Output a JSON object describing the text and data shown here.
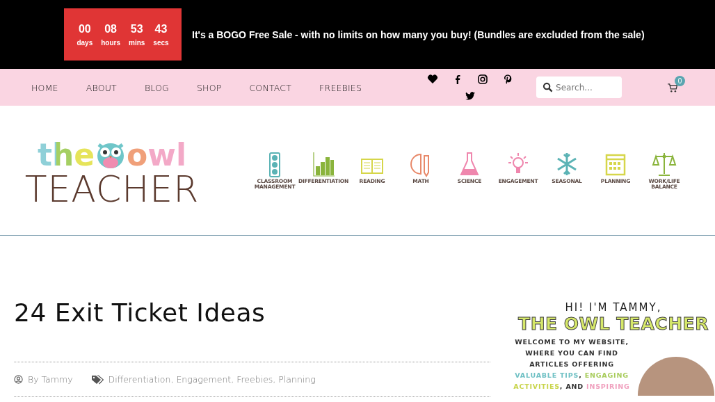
{
  "promo_bar": {
    "countdown": [
      {
        "value": "00",
        "unit": "days"
      },
      {
        "value": "08",
        "unit": "hours"
      },
      {
        "value": "53",
        "unit": "mins"
      },
      {
        "value": "43",
        "unit": "secs"
      }
    ],
    "message": "It's a BOGO Free Sale - with no limits on how many you buy! (Bundles are excluded from the sale)"
  },
  "nav": {
    "items": [
      "HOME",
      "ABOUT",
      "BLOG",
      "SHOP",
      "CONTACT",
      "FREEBIES"
    ],
    "social": [
      {
        "kind": "heart"
      },
      {
        "kind": "facebook"
      },
      {
        "kind": "instagram"
      },
      {
        "kind": "pinterest"
      },
      {
        "kind": "twitter"
      }
    ],
    "search": {
      "placeholder": "Search..."
    },
    "cart_count": "0"
  },
  "logo": {
    "top_left": "the",
    "top_right": "owl",
    "bottom": "TEACHER"
  },
  "categories": [
    {
      "label": "CLASSROOM MANAGEMENT",
      "kind": "traffic-light",
      "color": "#5bb3b5"
    },
    {
      "label": "DIFFERENTIATION",
      "kind": "bar-chart",
      "color": "#8ab43c"
    },
    {
      "label": "READING",
      "kind": "book",
      "color": "#d6d64a"
    },
    {
      "label": "MATH",
      "kind": "ruler-pencil",
      "color": "#e8896a"
    },
    {
      "label": "SCIENCE",
      "kind": "flask",
      "color": "#ef86ad"
    },
    {
      "label": "ENGAGEMENT",
      "kind": "lightbulb",
      "color": "#ef86ad"
    },
    {
      "label": "SEASONAL",
      "kind": "snowflake",
      "color": "#5bb3b5"
    },
    {
      "label": "PLANNING",
      "kind": "calendar",
      "color": "#d6d64a"
    },
    {
      "label": "WORK/LIFE BALANCE",
      "kind": "scales",
      "color": "#8ab43c"
    }
  ],
  "post": {
    "title": "24 Exit Ticket Ideas",
    "author": "By Tammy",
    "tags": [
      "Differentiation,",
      "Engagement,",
      "Freebies,",
      "Planning"
    ]
  },
  "sidebar": {
    "greeting": "HI! I'M TAMMY,",
    "brand": "THE OWL TEACHER",
    "intro": [
      "WELCOME TO MY WEBSITE,",
      "WHERE YOU CAN FIND",
      "ARTICLES OFFERING"
    ],
    "highlights": [
      {
        "kind": "accent",
        "text": "VALUABLE TIPS",
        "color": "#6fc0c4"
      },
      {
        "kind": "plain",
        "text": ", "
      },
      {
        "kind": "accent",
        "text": "ENGAGING",
        "color": "#a8cc5c"
      },
      {
        "kind": "accent",
        "text": "ACTIVITIES",
        "color": "#c8d44a"
      },
      {
        "kind": "plain",
        "text": ", AND "
      },
      {
        "kind": "accent",
        "text": "INSPIRING",
        "color": "#f0a0be"
      }
    ]
  }
}
